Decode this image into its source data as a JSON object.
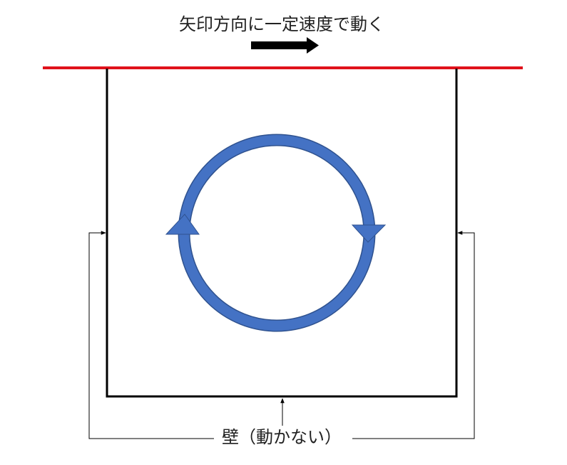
{
  "labels": {
    "motion_direction": "矢印方向に一定速度で動く",
    "wall": "壁（動かない）"
  },
  "colors": {
    "moving_lid": "#e0121b",
    "circulation": "#4472c4",
    "circulation_stroke": "#2f528f",
    "wall": "#000000",
    "leader": "#000000",
    "direction_arrow": "#000000"
  },
  "icons": {
    "direction": "right-arrow-icon",
    "circulation": "clockwise-circular-arrow-icon"
  }
}
